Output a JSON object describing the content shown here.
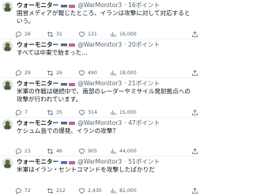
{
  "colors": {
    "text": "#0f1419",
    "secondary": "#536471",
    "divider": "#eff3f4"
  },
  "author": {
    "name": "ウォーモニター",
    "handle": "@WarMonitor3",
    "flag_icons": [
      "ukraine-flag-icon",
      "uk-flag-icon"
    ]
  },
  "tweets": [
    {
      "points": "· 16ポイント",
      "text": "国営メディアが報じたところ、イランは攻撃に対して対応するという。",
      "replies": "26",
      "retweets": "31",
      "likes": "131",
      "views": "16,000"
    },
    {
      "points": "· 20ポイント",
      "text": "すべては中東で始まった…",
      "replies": "29",
      "retweets": "26",
      "likes": "490",
      "views": "18,000"
    },
    {
      "points": "· 21ポイント",
      "text": "米軍の作戦は継続中で、南部のレーダーやミサイル発射拠点への攻撃が行われています。",
      "replies": "7",
      "retweets": "35",
      "likes": "314",
      "views": "15,000"
    },
    {
      "points": "· 47ポイント",
      "text": "ケシュム島での爆発、イランの攻撃？",
      "replies": "23",
      "retweets": "46",
      "likes": "905",
      "views": "44,000"
    },
    {
      "points": "· 51ポイント",
      "text": "米軍はイラン・セントコマンドを攻撃したばかりだ",
      "replies": "72",
      "retweets": "212",
      "likes": "2,430",
      "views": "81,000"
    }
  ]
}
